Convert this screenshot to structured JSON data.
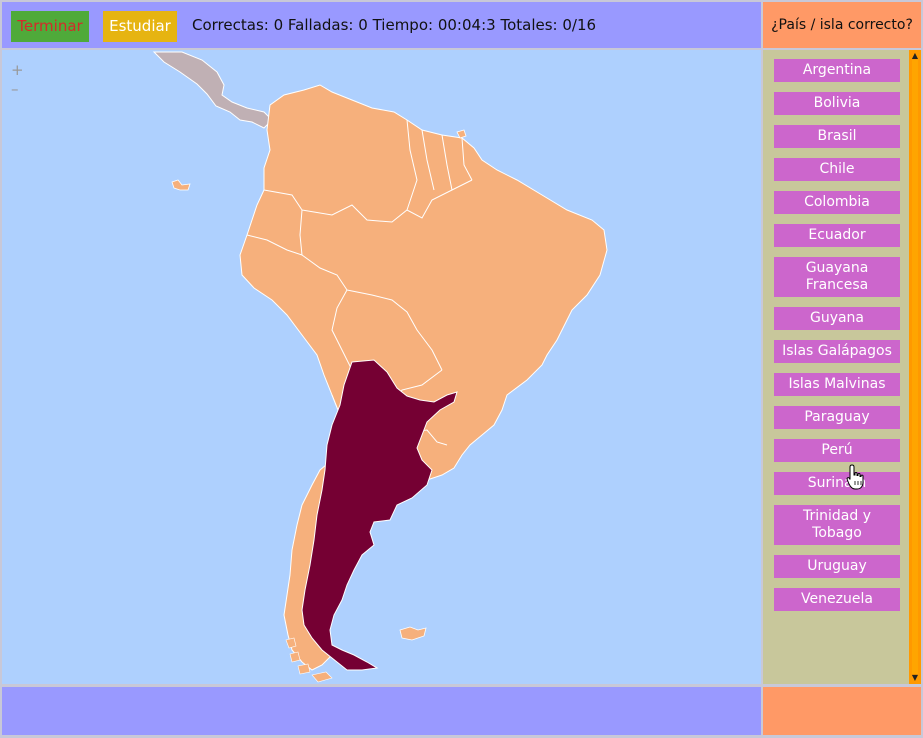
{
  "toolbar": {
    "terminar_label": "Terminar",
    "estudiar_label": "Estudiar"
  },
  "stats": {
    "correct_label": "Correctas:",
    "correct_value": "0",
    "failed_label": "Falladas:",
    "failed_value": "0",
    "time_label": "Tiempo:",
    "time_value": "00:04:3",
    "totals_label": "Totales:",
    "totals_value": "0/16"
  },
  "question": "¿País / isla correcto?",
  "zoom": {
    "in": "+",
    "out": "–"
  },
  "countries": [
    "Argentina",
    "Bolivia",
    "Brasil",
    "Chile",
    "Colombia",
    "Ecuador",
    "Guayana Francesa",
    "Guyana",
    "Islas Galápagos",
    "Islas Malvinas",
    "Paraguay",
    "Perú",
    "Surinam",
    "Trinidad y Tobago",
    "Uruguay",
    "Venezuela"
  ],
  "colors": {
    "land": "#f6b07c",
    "highlight": "#750033",
    "ocean": "#aed0fe",
    "central_america": "#c0b0b4",
    "button": "#cc66cc"
  },
  "icons": {
    "cursor": "hand-pointer-icon"
  }
}
